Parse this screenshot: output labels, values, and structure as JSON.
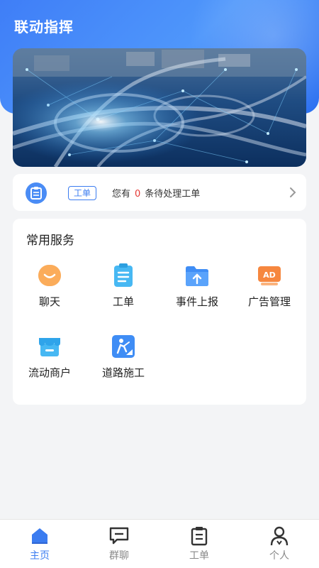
{
  "header": {
    "title": "联动指挥"
  },
  "notice": {
    "tag": "工单",
    "prefix": "您有",
    "count": "0",
    "suffix": "条待处理工单"
  },
  "services": {
    "title": "常用服务",
    "items": [
      {
        "label": "聊天",
        "icon": "chat-smile-icon"
      },
      {
        "label": "工单",
        "icon": "clipboard-icon"
      },
      {
        "label": "事件上报",
        "icon": "folder-upload-icon"
      },
      {
        "label": "广告管理",
        "icon": "ad-icon"
      },
      {
        "label": "流动商户",
        "icon": "store-icon"
      },
      {
        "label": "道路施工",
        "icon": "road-work-icon"
      }
    ]
  },
  "tabbar": {
    "items": [
      {
        "label": "主页",
        "icon": "home-icon",
        "active": true
      },
      {
        "label": "群聊",
        "icon": "group-chat-icon",
        "active": false
      },
      {
        "label": "工单",
        "icon": "clipboard-icon",
        "active": false
      },
      {
        "label": "个人",
        "icon": "person-icon",
        "active": false
      }
    ]
  },
  "colors": {
    "primary": "#3b7cf0",
    "alert": "#e53935",
    "background": "#f3f4f6"
  }
}
